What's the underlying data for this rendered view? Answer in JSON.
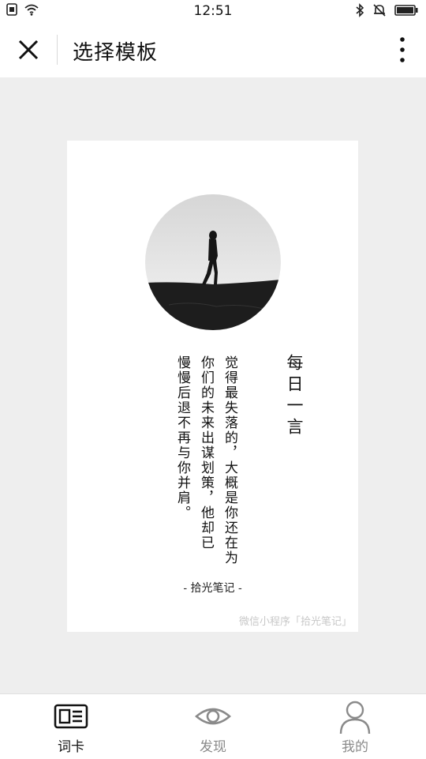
{
  "status_bar": {
    "time": "12:51"
  },
  "nav": {
    "title": "选择模板"
  },
  "card": {
    "heading": "每日一言",
    "quote_lines": [
      "觉得最失落的，大概是你还在为",
      "你们的未来出谋划策，他却已",
      "慢慢后退不再与你并肩。"
    ],
    "signature": "- 拾光笔记 -",
    "watermark": "微信小程序「拾光笔记」"
  },
  "tabs": [
    {
      "label": "词卡",
      "icon": "id-card-icon",
      "active": true
    },
    {
      "label": "发现",
      "icon": "eye-icon",
      "active": false
    },
    {
      "label": "我的",
      "icon": "person-icon",
      "active": false
    }
  ],
  "colors": {
    "background": "#eeeeee",
    "card": "#ffffff",
    "inactive": "#8a8a8a"
  }
}
